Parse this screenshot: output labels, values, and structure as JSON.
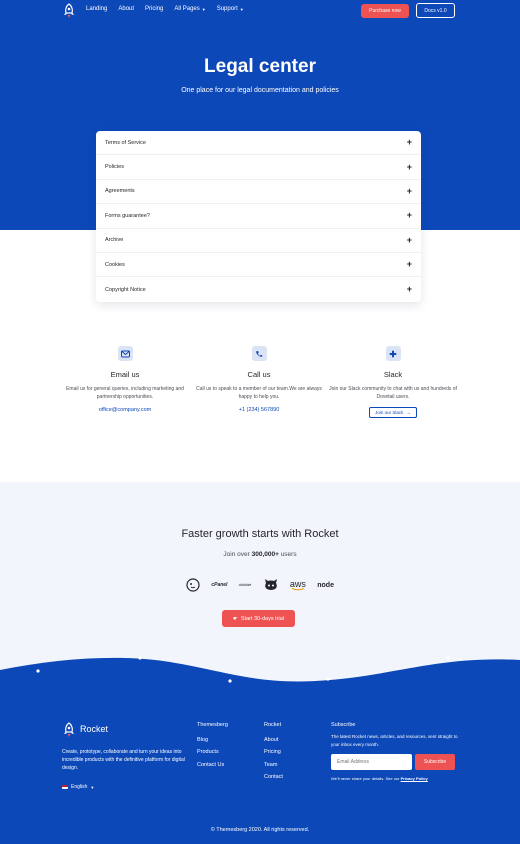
{
  "nav": {
    "links": [
      {
        "label": "Landing",
        "dropdown": false
      },
      {
        "label": "About",
        "dropdown": false
      },
      {
        "label": "Pricing",
        "dropdown": false
      },
      {
        "label": "All Pages",
        "dropdown": true
      },
      {
        "label": "Support",
        "dropdown": true
      }
    ],
    "purchase_label": "Purchase now",
    "docs_label": "Docs v1.0"
  },
  "hero": {
    "title": "Legal center",
    "subtitle": "One place for our legal documentation and policies"
  },
  "accordion": {
    "items": [
      {
        "label": "Terms of Service"
      },
      {
        "label": "Policies"
      },
      {
        "label": "Agreements"
      },
      {
        "label": "Forms guarantee?"
      },
      {
        "label": "Archive"
      },
      {
        "label": "Cookies"
      },
      {
        "label": "Copyright Notice"
      }
    ],
    "expand_symbol": "+"
  },
  "contact": {
    "email": {
      "title": "Email us",
      "text": "Email us for general queries, including marketing and partnership opportunities.",
      "link": "office@company.com",
      "icon": "envelope-icon"
    },
    "call": {
      "title": "Call us",
      "text": "Call us to speak to a member of our team.We are always happy to help you.",
      "link": "+1 (234) 567890",
      "icon": "phone-icon"
    },
    "slack": {
      "title": "Slack",
      "text": "Join our Slack community to chat with us and hundreds of Dovetail users.",
      "button": "Join our Slack",
      "icon": "slack-icon"
    }
  },
  "growth": {
    "title": "Faster growth starts with Rocket",
    "sub_prefix": "Join over ",
    "sub_bold": "300,000+",
    "sub_suffix": " users",
    "brands": [
      "mailchimp-icon",
      "cPanel",
      "dribbble",
      "github-icon",
      "aws",
      "node"
    ],
    "trial_label": "Start 30-days trial"
  },
  "footer": {
    "brand": "Rocket",
    "description": "Create, prototype, collaborate and turn your ideas into incredible products with the definitive platform for digital design.",
    "language": "English",
    "columns": [
      {
        "title": "Themesberg",
        "links": [
          "Blog",
          "Products",
          "Contact Us"
        ]
      },
      {
        "title": "Rocket",
        "links": [
          "About",
          "Pricing",
          "Team",
          "Contact"
        ]
      }
    ],
    "subscribe": {
      "title": "Subscribe",
      "text": "The latest Rocket news, articles, and resources, sent straight to your inbox every month.",
      "placeholder": "Email Address",
      "button": "Subscribe",
      "note_prefix": "We'll never share your details. See our ",
      "note_link": "Privacy Policy"
    },
    "copyright": "© Themesberg 2020. All rights reserved."
  },
  "colors": {
    "primary": "#0c48b8",
    "accent": "#ee5253",
    "light_bg": "#f2f5fb"
  }
}
